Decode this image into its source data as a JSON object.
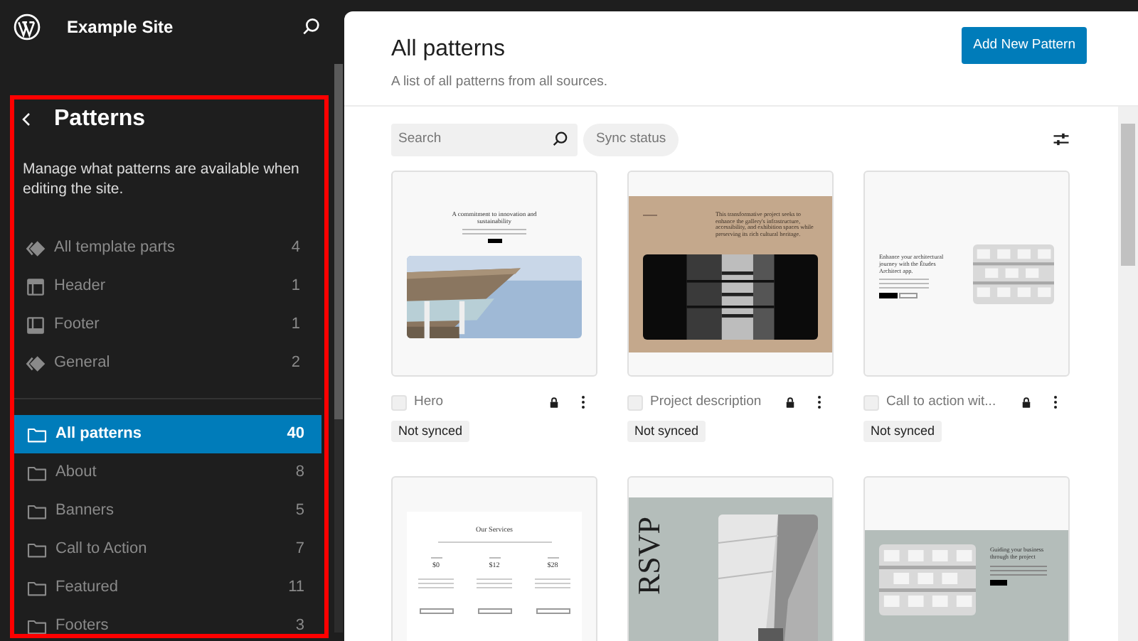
{
  "site": {
    "title": "Example Site"
  },
  "sidebar": {
    "title": "Patterns",
    "description": "Manage what patterns are available when editing the site.",
    "parts": [
      {
        "kind": "template",
        "label": "All template parts",
        "count": "4"
      },
      {
        "kind": "header",
        "label": "Header",
        "count": "1"
      },
      {
        "kind": "footer",
        "label": "Footer",
        "count": "1"
      },
      {
        "kind": "template",
        "label": "General",
        "count": "2"
      }
    ],
    "categories": [
      {
        "label": "All patterns",
        "count": "40",
        "selected": true
      },
      {
        "label": "About",
        "count": "8",
        "selected": false
      },
      {
        "label": "Banners",
        "count": "5",
        "selected": false
      },
      {
        "label": "Call to Action",
        "count": "7",
        "selected": false
      },
      {
        "label": "Featured",
        "count": "11",
        "selected": false
      },
      {
        "label": "Footers",
        "count": "3",
        "selected": false
      }
    ]
  },
  "main": {
    "title": "All patterns",
    "subtitle": "A list of all patterns from all sources.",
    "add_button": "Add New Pattern",
    "search": {
      "placeholder": "Search"
    },
    "sync_filter": "Sync status",
    "cards": [
      {
        "kind": "hero",
        "preview": {
          "heading": "A commitment to innovation and sustainability"
        },
        "title": "Hero",
        "checked": false,
        "locked": true,
        "badge": "Not synced"
      },
      {
        "kind": "project",
        "preview": {
          "heading": "This transformative project seeks to enhance the gallery's infrastructure, accessibility, and exhibition spaces while preserving its rich cultural heritage."
        },
        "title": "Project description",
        "checked": false,
        "locked": true,
        "badge": "Not synced"
      },
      {
        "kind": "cta",
        "preview": {
          "heading": "Enhance your architectural journey with the Études Architect app."
        },
        "title": "Call to action wit...",
        "checked": false,
        "locked": true,
        "badge": "Not synced"
      },
      {
        "kind": "services",
        "preview": {
          "heading": "Our Services",
          "prices": [
            "$0",
            "$12",
            "$28"
          ]
        }
      },
      {
        "kind": "rsvp",
        "preview": {
          "heading": "RSVP"
        }
      },
      {
        "kind": "guide",
        "preview": {
          "heading": "Guiding your business through the project"
        }
      }
    ]
  }
}
